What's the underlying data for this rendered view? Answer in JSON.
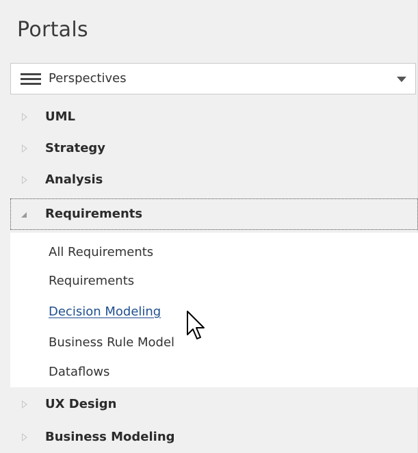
{
  "panel": {
    "title": "Portals"
  },
  "perspectives_dropdown": {
    "icon": "hamburger-menu-icon",
    "selected": "Perspectives",
    "caret_icon": "caret-down-icon"
  },
  "tree": {
    "nodes": [
      {
        "label": "UML",
        "expanded": false
      },
      {
        "label": "Strategy",
        "expanded": false
      },
      {
        "label": "Analysis",
        "expanded": false
      },
      {
        "label": "Requirements",
        "expanded": true,
        "selected": true
      },
      {
        "label": "UX Design",
        "expanded": false
      },
      {
        "label": "Business Modeling",
        "expanded": false
      }
    ],
    "requirements_children": [
      {
        "label": "All Requirements"
      },
      {
        "label": "Requirements"
      },
      {
        "label": "Decision Modeling",
        "hovered": true
      },
      {
        "label": "Business Rule Model"
      },
      {
        "label": "Dataflows"
      }
    ]
  },
  "colors": {
    "panel_bg": "#f0f0f0",
    "children_bg": "#ffffff",
    "link_hover": "#1e4f8f",
    "text": "#2b2b2b"
  },
  "pointer": {
    "icon": "mouse-pointer-icon"
  }
}
